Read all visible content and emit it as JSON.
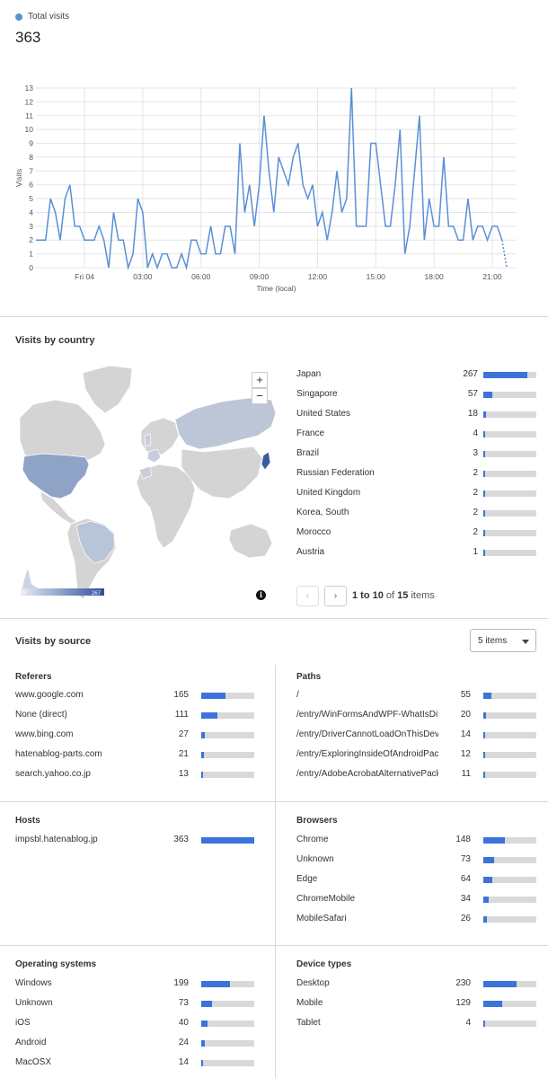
{
  "summary": {
    "legend_label": "Total visits",
    "legend_color": "#5b8fd6",
    "total": "363"
  },
  "chart_data": {
    "type": "line",
    "title": "",
    "ylabel": "Visits",
    "xlabel": "Time (local)",
    "ylim": [
      0,
      13
    ],
    "yticks": [
      "0",
      "1",
      "2",
      "3",
      "4",
      "5",
      "6",
      "7",
      "8",
      "9",
      "10",
      "11",
      "12",
      "13"
    ],
    "xticks": [
      {
        "label": "Fri 04",
        "hour": 0
      },
      {
        "label": "03:00",
        "hour": 3
      },
      {
        "label": "06:00",
        "hour": 6
      },
      {
        "label": "09:00",
        "hour": 9
      },
      {
        "label": "12:00",
        "hour": 12
      },
      {
        "label": "15:00",
        "hour": 15
      },
      {
        "label": "18:00",
        "hour": 18
      },
      {
        "label": "21:00",
        "hour": 21
      }
    ],
    "x_start_hour": -2.5,
    "x_end_hour": 22.25,
    "step_hours": 0.25,
    "grid": true,
    "series": [
      {
        "color": "#5b8fd6",
        "values": [
          2,
          2,
          2,
          5,
          4,
          2,
          5,
          6,
          3,
          3,
          2,
          2,
          2,
          3,
          2,
          0,
          4,
          2,
          2,
          0,
          1,
          5,
          4,
          0,
          1,
          0,
          1,
          1,
          0,
          0,
          1,
          0,
          2,
          2,
          1,
          1,
          3,
          1,
          1,
          3,
          3,
          1,
          9,
          4,
          6,
          3,
          6,
          11,
          7,
          4,
          8,
          7,
          6,
          8,
          9,
          6,
          5,
          6,
          3,
          4,
          2,
          4,
          7,
          4,
          5,
          13,
          3,
          3,
          3,
          9,
          9,
          6,
          3,
          3,
          6,
          10,
          1,
          3,
          7,
          11,
          2,
          5,
          3,
          3,
          8,
          3,
          3,
          2,
          2,
          5,
          2,
          3,
          3,
          2,
          3,
          3,
          2,
          0
        ]
      }
    ]
  },
  "country": {
    "title": "Visits by country",
    "zoom_in": "+",
    "zoom_out": "−",
    "scale_min": "0",
    "scale_max": "267",
    "info": "i",
    "rows": [
      {
        "label": "Japan",
        "value": 267,
        "text": "267"
      },
      {
        "label": "Singapore",
        "value": 57,
        "text": "57"
      },
      {
        "label": "United States",
        "value": 18,
        "text": "18"
      },
      {
        "label": "France",
        "value": 4,
        "text": "4"
      },
      {
        "label": "Brazil",
        "value": 3,
        "text": "3"
      },
      {
        "label": "Russian Federation",
        "value": 2,
        "text": "2"
      },
      {
        "label": "United Kingdom",
        "value": 2,
        "text": "2"
      },
      {
        "label": "Korea, South",
        "value": 2,
        "text": "2"
      },
      {
        "label": "Morocco",
        "value": 2,
        "text": "2"
      },
      {
        "label": "Austria",
        "value": 1,
        "text": "1"
      }
    ],
    "pager": {
      "prev": "‹",
      "next": "›",
      "range": "1 to 10",
      "of": "of",
      "total": "15",
      "suffix": "items"
    }
  },
  "source": {
    "title": "Visits by source",
    "select_value": "5 items",
    "groups": {
      "referers": {
        "title": "Referers",
        "max": 363,
        "rows": [
          {
            "label": "www.google.com",
            "value": 165,
            "text": "165"
          },
          {
            "label": "None (direct)",
            "value": 111,
            "text": "111"
          },
          {
            "label": "www.bing.com",
            "value": 27,
            "text": "27"
          },
          {
            "label": "hatenablog-parts.com",
            "value": 21,
            "text": "21"
          },
          {
            "label": "search.yahoo.co.jp",
            "value": 13,
            "text": "13"
          }
        ]
      },
      "paths": {
        "title": "Paths",
        "max": 363,
        "rows": [
          {
            "label": "/",
            "value": 55,
            "text": "55"
          },
          {
            "label": "/entry/WinFormsAndWPF-WhatIsDiff...",
            "value": 20,
            "text": "20"
          },
          {
            "label": "/entry/DriverCannotLoadOnThisDevice",
            "value": 14,
            "text": "14"
          },
          {
            "label": "/entry/ExploringInsideOfAndroidPack...",
            "value": 12,
            "text": "12"
          },
          {
            "label": "/entry/AdobeAcrobatAlternativePack...",
            "value": 11,
            "text": "11"
          }
        ]
      },
      "hosts": {
        "title": "Hosts",
        "max": 363,
        "rows": [
          {
            "label": "impsbl.hatenablog.jp",
            "value": 363,
            "text": "363"
          }
        ]
      },
      "browsers": {
        "title": "Browsers",
        "max": 363,
        "rows": [
          {
            "label": "Chrome",
            "value": 148,
            "text": "148"
          },
          {
            "label": "Unknown",
            "value": 73,
            "text": "73"
          },
          {
            "label": "Edge",
            "value": 64,
            "text": "64"
          },
          {
            "label": "ChromeMobile",
            "value": 34,
            "text": "34"
          },
          {
            "label": "MobileSafari",
            "value": 26,
            "text": "26"
          }
        ]
      },
      "os": {
        "title": "Operating systems",
        "max": 363,
        "rows": [
          {
            "label": "Windows",
            "value": 199,
            "text": "199"
          },
          {
            "label": "Unknown",
            "value": 73,
            "text": "73"
          },
          {
            "label": "iOS",
            "value": 40,
            "text": "40"
          },
          {
            "label": "Android",
            "value": 24,
            "text": "24"
          },
          {
            "label": "MacOSX",
            "value": 14,
            "text": "14"
          }
        ]
      },
      "devices": {
        "title": "Device types",
        "max": 363,
        "rows": [
          {
            "label": "Desktop",
            "value": 230,
            "text": "230"
          },
          {
            "label": "Mobile",
            "value": 129,
            "text": "129"
          },
          {
            "label": "Tablet",
            "value": 4,
            "text": "4"
          }
        ]
      }
    }
  },
  "colors": {
    "bar_fill": "#3a74d9",
    "bar_track": "#d9d9d9",
    "map_land": "#d4d4d4",
    "map_us": "#8fa3c7",
    "map_ru": "#bcc6d6"
  }
}
